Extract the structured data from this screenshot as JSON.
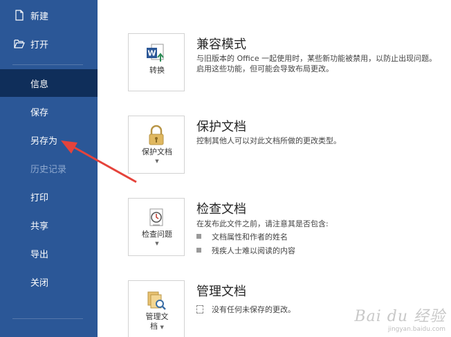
{
  "sidebar": {
    "items": [
      {
        "label": "新建"
      },
      {
        "label": "打开"
      },
      {
        "label": "信息"
      },
      {
        "label": "保存"
      },
      {
        "label": "另存为"
      },
      {
        "label": "历史记录"
      },
      {
        "label": "打印"
      },
      {
        "label": "共享"
      },
      {
        "label": "导出"
      },
      {
        "label": "关闭"
      }
    ]
  },
  "main": {
    "compat": {
      "tile_label": "转换",
      "title": "兼容模式",
      "desc_line1": "与旧版本的 Office 一起使用时，某些新功能被禁用，以防止出现问题。",
      "desc_line2": "启用这些功能，但可能会导致布局更改。"
    },
    "protect": {
      "tile_label": "保护文档",
      "title": "保护文档",
      "desc": "控制其他人可以对此文档所做的更改类型。"
    },
    "inspect": {
      "tile_label": "检查问题",
      "title": "检查文档",
      "desc": "在发布此文件之前，请注意其是否包含:",
      "bullets": [
        "文档属性和作者的姓名",
        "残疾人士难以阅读的内容"
      ]
    },
    "manage": {
      "tile_label_line1": "管理文",
      "tile_label_line2": "档",
      "title": "管理文档",
      "desc": "没有任何未保存的更改。"
    }
  },
  "watermark": {
    "line1": "Bai du 经验",
    "line2": "jingyan.baidu.com"
  },
  "colors": {
    "sidebar_bg": "#2b5797",
    "sidebar_selected": "#0f2e5a",
    "arrow": "#e5433b"
  }
}
